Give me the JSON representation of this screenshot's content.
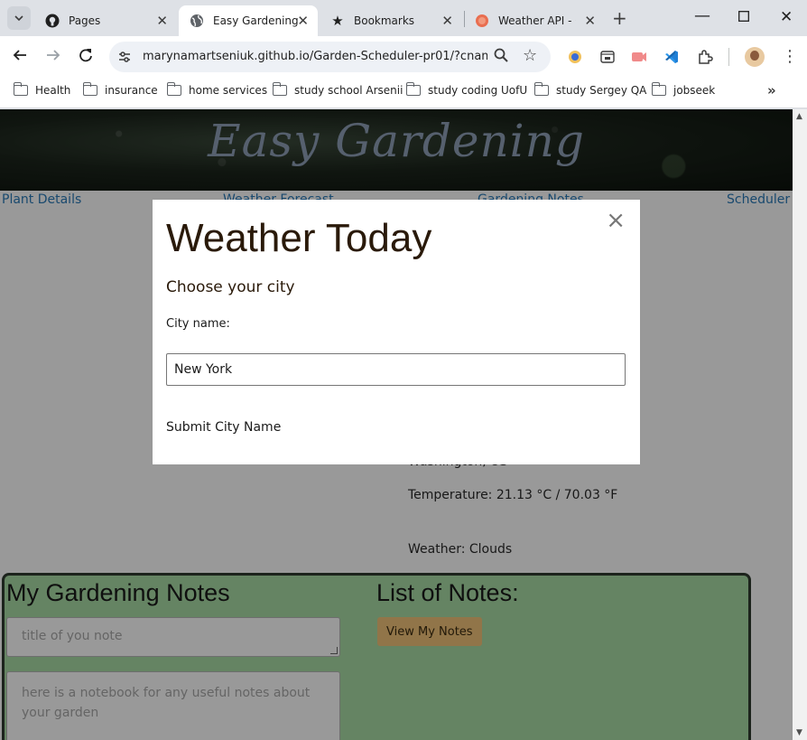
{
  "browser": {
    "tabs": [
      {
        "title": "Pages",
        "icon": "github-icon"
      },
      {
        "title": "Easy Gardening",
        "icon": "globe-icon",
        "active": true
      },
      {
        "title": "Bookmarks",
        "icon": "star-icon"
      },
      {
        "title": "Weather API - O",
        "icon": "openweather-icon"
      }
    ],
    "url": "marynamartseniuk.github.io/Garden-Scheduler-pr01/?cnam...",
    "bookmarks": [
      "Health",
      "insurance",
      "home services",
      "study school Arsenii",
      "study coding UofU",
      "study Sergey QA",
      "jobseek"
    ]
  },
  "page": {
    "hero_title": "Easy Gardening",
    "nav": [
      "Plant Details",
      "Weather Forecast",
      "Gardening Notes",
      "Scheduler"
    ],
    "weather": {
      "location": "Washington, US",
      "temperature": "Temperature: 21.13 °C / 70.03 °F",
      "conditions": "Weather: Clouds"
    },
    "notes": {
      "heading": "My Gardening Notes",
      "title_placeholder": "title of you note",
      "body_placeholder": "here is a notebook for any useful notes about your garden",
      "list_heading": "List of Notes:",
      "view_button": "View My Notes"
    }
  },
  "modal": {
    "title": "Weather Today",
    "subtitle": "Choose your city",
    "label": "City name:",
    "input_value": "New York",
    "submit": "Submit City Name",
    "close": "×"
  }
}
